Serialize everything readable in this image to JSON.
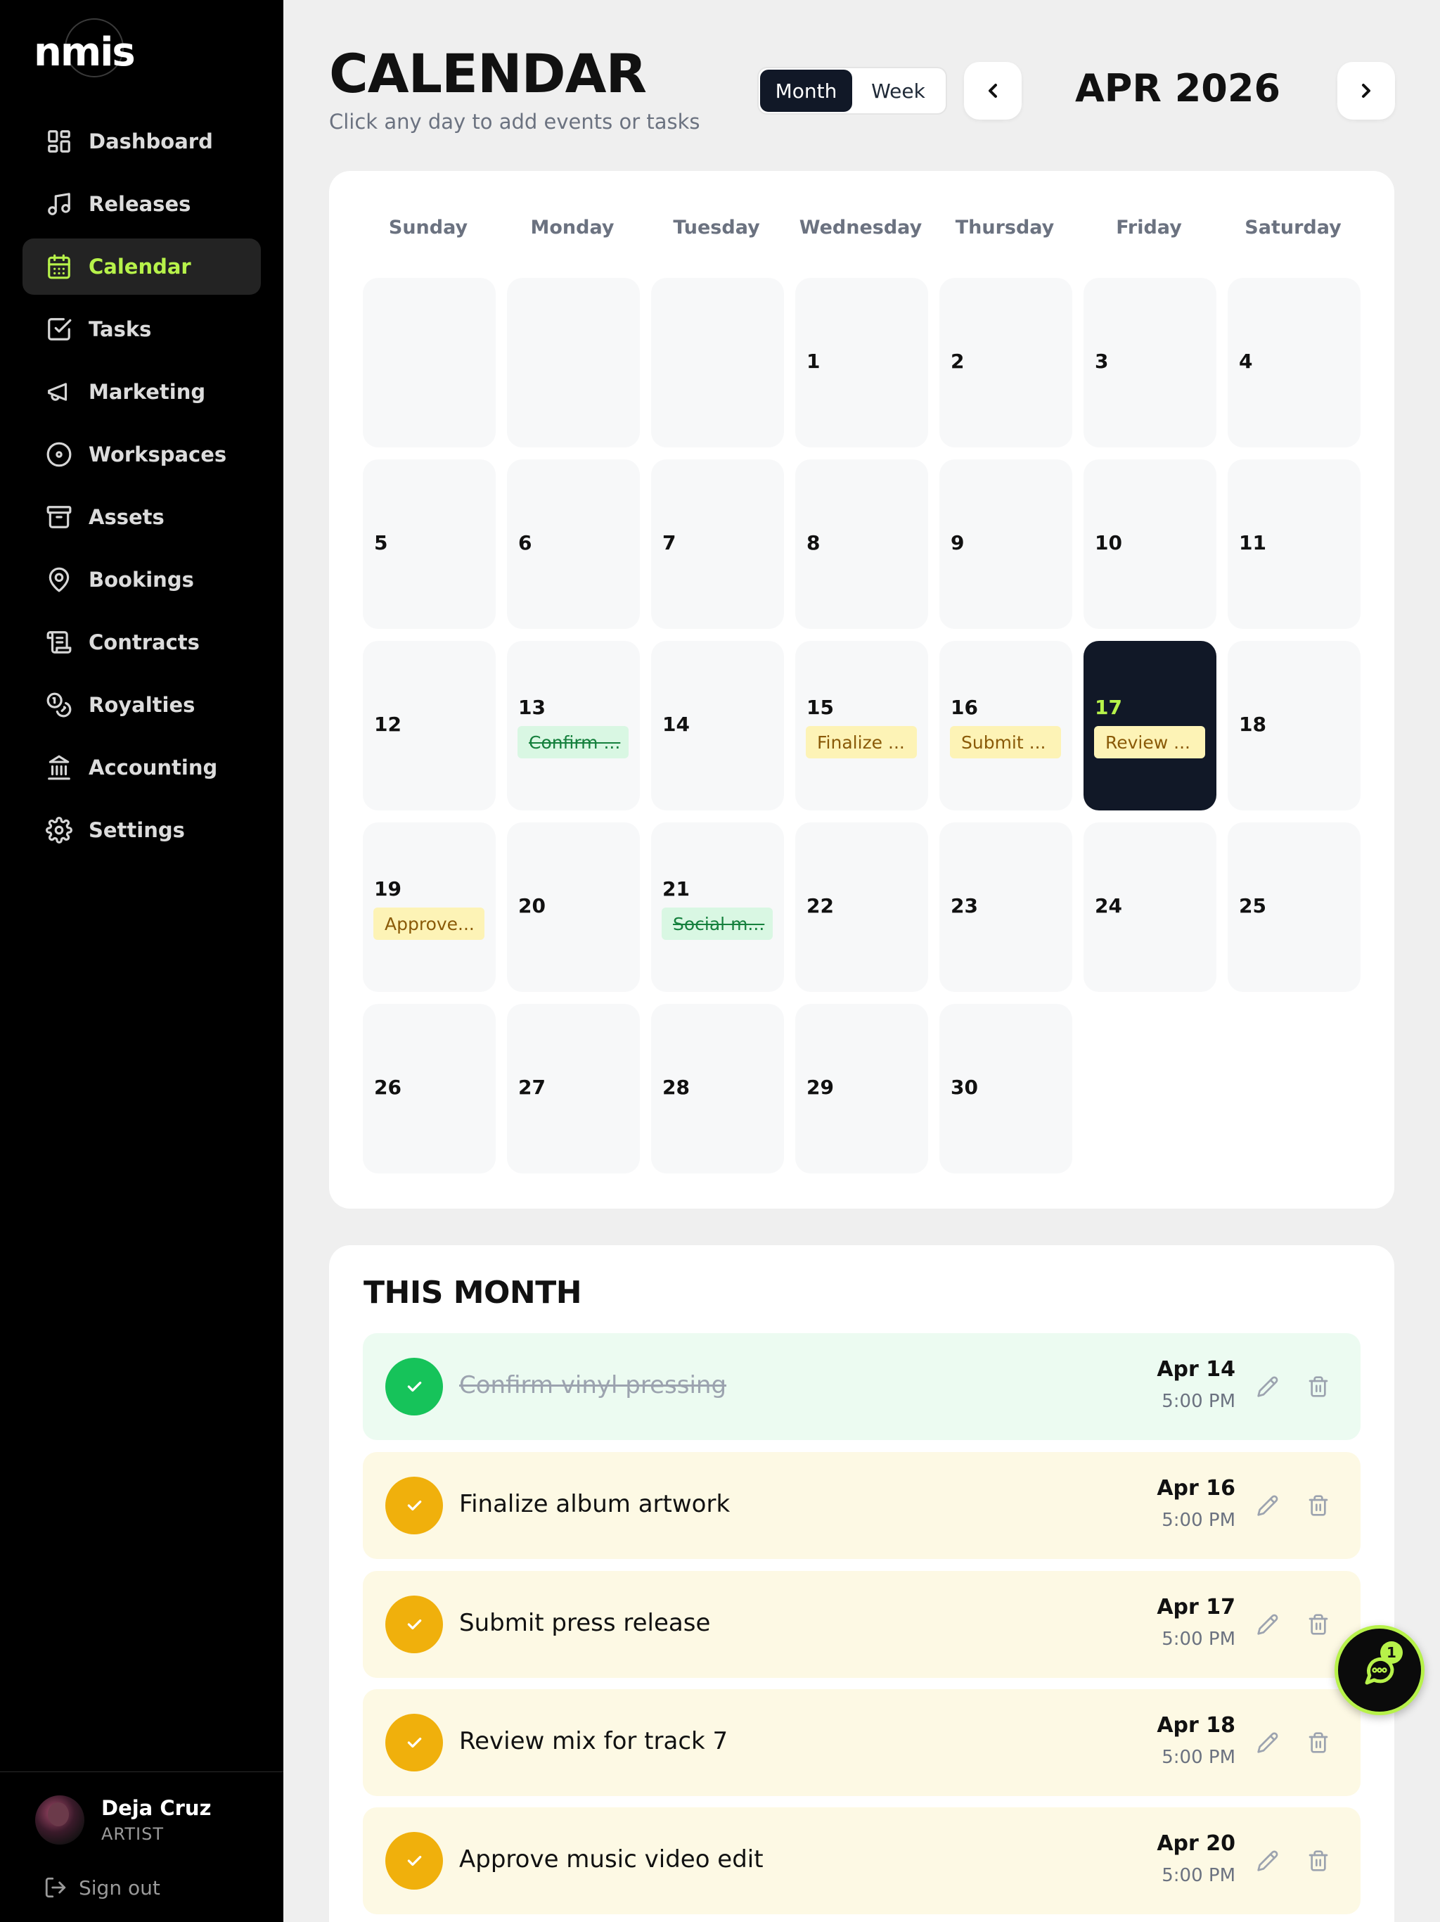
{
  "brand": {
    "logo_text": "nmis"
  },
  "sidebar": {
    "items": [
      {
        "label": "Dashboard",
        "icon": "grid-icon",
        "active": false
      },
      {
        "label": "Releases",
        "icon": "music-note-icon",
        "active": false
      },
      {
        "label": "Calendar",
        "icon": "calendar-icon",
        "active": true
      },
      {
        "label": "Tasks",
        "icon": "checkbox-icon",
        "active": false
      },
      {
        "label": "Marketing",
        "icon": "megaphone-icon",
        "active": false
      },
      {
        "label": "Workspaces",
        "icon": "disc-icon",
        "active": false
      },
      {
        "label": "Assets",
        "icon": "archive-icon",
        "active": false
      },
      {
        "label": "Bookings",
        "icon": "map-pin-icon",
        "active": false
      },
      {
        "label": "Contracts",
        "icon": "scroll-icon",
        "active": false
      },
      {
        "label": "Royalties",
        "icon": "coins-icon",
        "active": false
      },
      {
        "label": "Accounting",
        "icon": "bank-icon",
        "active": false
      },
      {
        "label": "Settings",
        "icon": "gear-icon",
        "active": false
      }
    ],
    "user": {
      "name": "Deja Cruz",
      "role": "ARTIST"
    },
    "signout_label": "Sign out"
  },
  "header": {
    "title": "CALENDAR",
    "subtitle": "Click any day to add events or tasks",
    "view_toggle": {
      "month_label": "Month",
      "week_label": "Week",
      "selected": "Month"
    },
    "current_month": "APR 2026"
  },
  "calendar": {
    "weekdays": [
      "Sunday",
      "Monday",
      "Tuesday",
      "Wednesday",
      "Thursday",
      "Friday",
      "Saturday"
    ],
    "start_weekday_index": 3,
    "days_in_month": 30,
    "today": 17,
    "events": [
      {
        "day": 13,
        "label": "Confirm ...",
        "status": "done"
      },
      {
        "day": 15,
        "label": "Finalize ...",
        "status": "pending"
      },
      {
        "day": 16,
        "label": "Submit ...",
        "status": "pending"
      },
      {
        "day": 17,
        "label": "Review ...",
        "status": "pending"
      },
      {
        "day": 19,
        "label": "Approve...",
        "status": "pending"
      },
      {
        "day": 21,
        "label": "Social m...",
        "status": "done"
      }
    ]
  },
  "this_month": {
    "heading": "THIS MONTH",
    "tasks": [
      {
        "title": "Confirm vinyl pressing",
        "date": "Apr 14",
        "time": "5:00 PM",
        "status": "done"
      },
      {
        "title": "Finalize album artwork",
        "date": "Apr 16",
        "time": "5:00 PM",
        "status": "pending"
      },
      {
        "title": "Submit press release",
        "date": "Apr 17",
        "time": "5:00 PM",
        "status": "pending"
      },
      {
        "title": "Review mix for track 7",
        "date": "Apr 18",
        "time": "5:00 PM",
        "status": "pending"
      },
      {
        "title": "Approve music video edit",
        "date": "Apr 20",
        "time": "5:00 PM",
        "status": "pending"
      }
    ]
  },
  "chat": {
    "badge_count": "1"
  },
  "colors": {
    "accent": "#b7f24a",
    "sidebar_bg": "#000000",
    "today_bg": "#111827",
    "pending_chip": "#fdf3b6",
    "done_chip": "#d9f7e3",
    "done_check": "#16c35a",
    "pending_check": "#f0b00c"
  }
}
